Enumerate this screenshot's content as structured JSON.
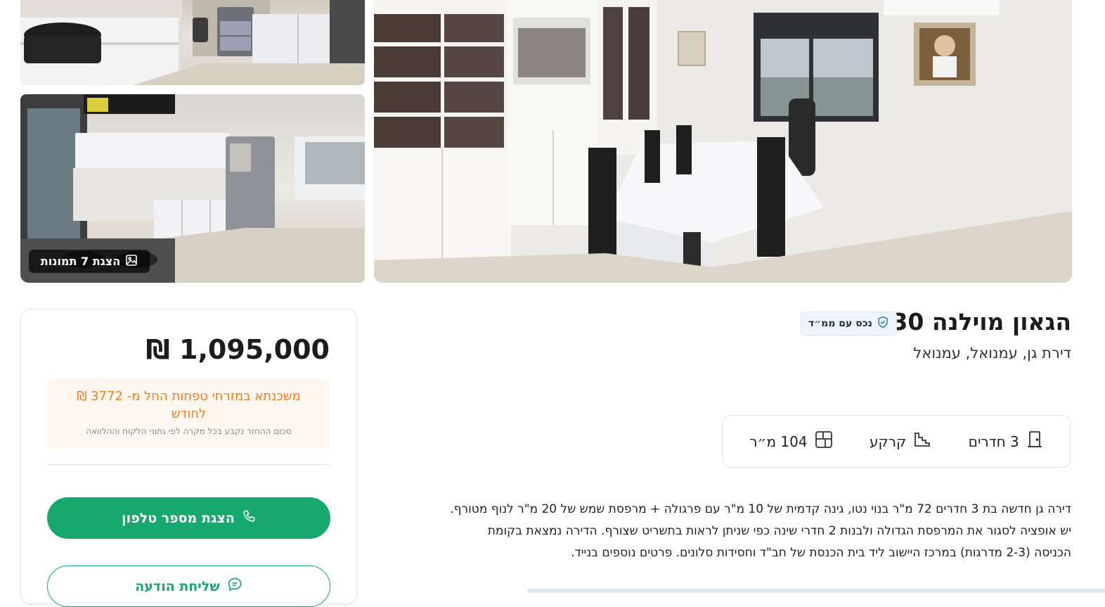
{
  "gallery": {
    "show_photos_label": "הצגת 7 תמונות"
  },
  "listing": {
    "title": "הגאון מוילנה 30",
    "badge": "נכס עם ממ״ד",
    "subtitle": "דירת גן, עמנואל, עמנואל",
    "features": [
      {
        "icon": "door-icon",
        "label": "3 חדרים"
      },
      {
        "icon": "stairs-icon",
        "label": "קרקע"
      },
      {
        "icon": "floorplan-icon",
        "label": "104 מ״ר"
      }
    ],
    "description_lines": [
      "דירה גן חדשה בת 3 חדרים 72 מ\"ר בנוי נטו, גינה קדמית של 10 מ\"ר עם פרגולה + מרפסת שמש של 20 מ\"ר לנוף מטורף.",
      "יש אופציה לסגור את המרפסת הגדולה ולבנות 2 חדרי שינה כפי שניתן לראות בתשריט שצורף. הדירה נמצאת בקומת",
      "הכניסה (2-3 מדרגות) במרכז היישוב ליד בית הכנסת של חב\"ד וחסידות סלונים. פרטים נוספים בנייד."
    ]
  },
  "pricing": {
    "price": "1,095,000 ₪",
    "mortgage_text": "משכנתא במזרחי טפחות החל מ- 3772 ₪ לחודש",
    "mortgage_note": "סכום ההחזר נקבע בכל מקרה לפי נתוני הלקוח וההלוואה",
    "show_phone_label": "הצגת מספר טלפון",
    "send_message_label": "שליחת הודעה"
  },
  "colors": {
    "primary_green": "#16a86c",
    "mortgage_orange": "#f07d1d",
    "badge_blue": "#3b82c4"
  }
}
